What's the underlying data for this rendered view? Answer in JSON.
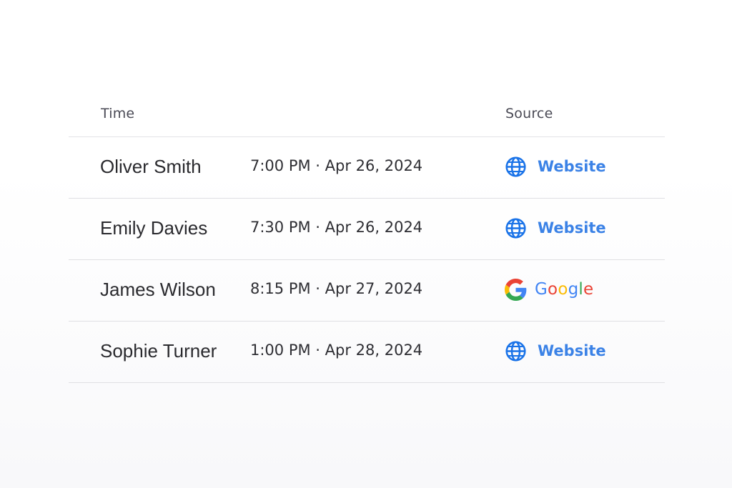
{
  "table": {
    "headers": {
      "time": "Time",
      "source": "Source"
    },
    "rows": [
      {
        "name": "Oliver Smith",
        "time": "7:00 PM · Apr 26, 2024",
        "source": "Website",
        "source_icon": "globe-icon"
      },
      {
        "name": "Emily Davies",
        "time": "7:30 PM · Apr 26, 2024",
        "source": "Website",
        "source_icon": "globe-icon"
      },
      {
        "name": "James Wilson",
        "time": "8:15 PM · Apr 27, 2024",
        "source": "Google",
        "source_icon": "google-icon"
      },
      {
        "name": "Sophie Turner",
        "time": "1:00 PM · Apr 28, 2024",
        "source": "Website",
        "source_icon": "globe-icon"
      }
    ]
  },
  "colors": {
    "link_blue": "#3b82e6",
    "globe_blue": "#1a73e8",
    "divider": "#dfdfe3",
    "google_blue": "#4285F4",
    "google_red": "#EA4335",
    "google_yellow": "#FBBC05",
    "google_green": "#34A853"
  }
}
